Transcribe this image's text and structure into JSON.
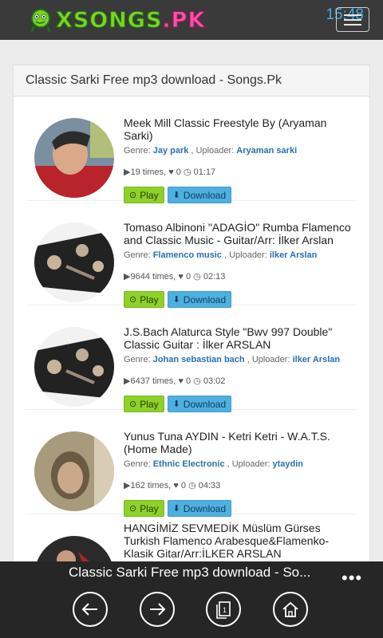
{
  "header": {
    "logo_text": "XSONGS",
    "logo_suffix": ".PK",
    "clock": "15:48",
    "menu_icon": "hamburger-icon"
  },
  "panel": {
    "title": "Classic Sarki Free mp3 download - Songs.Pk"
  },
  "labels": {
    "genre": "Genre:",
    "uploader": "Uploader:",
    "times_suffix": "times,",
    "play": "Play",
    "download": "Download"
  },
  "songs": [
    {
      "title": "Meek Mill Classic Freestyle By (Aryaman Sarki)",
      "genre": "Jay park",
      "uploader": "Aryaman sarki",
      "plays": "19",
      "likes": "0",
      "duration": "01:17"
    },
    {
      "title": "Tomaso Albinoni \"ADAGİO\" Rumba Flamenco and Classic Music - Guitar/Arr: İlker Arslan",
      "genre": "Flamenco music",
      "uploader": "ilker Arslan",
      "plays": "9644",
      "likes": "0",
      "duration": "02:13"
    },
    {
      "title": "J.S.Bach Alaturca Style \"Bwv 997 Double\" Classic Guitar : İlker ARSLAN",
      "genre": "Johan sebastian bach",
      "uploader": "ilker Arslan",
      "plays": "6437",
      "likes": "0",
      "duration": "03:02"
    },
    {
      "title": "Yunus Tuna AYDIN - Ketri Ketri - W.A.T.S. (Home Made)",
      "genre": "Ethnic Electronic",
      "uploader": "ytaydin",
      "plays": "162",
      "likes": "0",
      "duration": "04:33"
    },
    {
      "title": "HANGİMİZ SEVMEDİK Müslüm Gürses Turkish Flamenco Arabesque&Flamenko-Klasik Gitar/Arr:İLKER ARSLAN",
      "genre": "",
      "uploader": "",
      "plays": "",
      "likes": "",
      "duration": ""
    }
  ],
  "appbar": {
    "title": "Classic Sarki Free mp3 download - So...",
    "more": "•••",
    "tabs_count": "1",
    "buttons": [
      "back-icon",
      "forward-icon",
      "tabs-icon",
      "home-icon"
    ]
  }
}
